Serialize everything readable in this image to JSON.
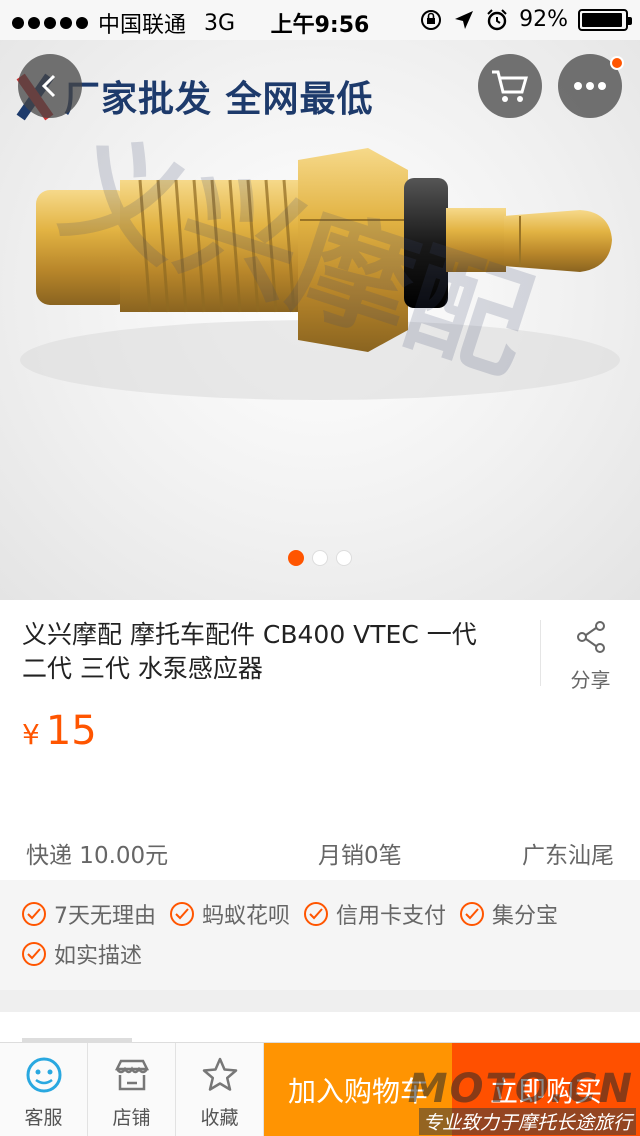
{
  "status_bar": {
    "carrier": "中国联通",
    "network": "3G",
    "time": "上午9:56",
    "battery": "92%",
    "battery_level": 0.92
  },
  "hero": {
    "watermark_banner": "厂家批发 全网最低",
    "watermark_brand": "义兴摩配",
    "page_indicator": {
      "count": 3,
      "active": 1
    }
  },
  "product": {
    "title": "义兴摩配 摩托车配件 CB400 VTEC 一代 二代 三代 水泵感应器",
    "share_label": "分享",
    "currency": "¥",
    "price": "15",
    "shipping": "快递 10.00元",
    "monthly_sales": "月销0笔",
    "location": "广东汕尾"
  },
  "services": [
    {
      "label": "7天无理由"
    },
    {
      "label": "蚂蚁花呗"
    },
    {
      "label": "信用卡支付"
    },
    {
      "label": "集分宝"
    },
    {
      "label": "如实描述"
    }
  ],
  "bottom_bar": {
    "tabs": [
      {
        "label": "客服",
        "icon": "customer-service-icon"
      },
      {
        "label": "店铺",
        "icon": "shop-icon"
      },
      {
        "label": "收藏",
        "icon": "star-icon"
      }
    ],
    "add_to_cart": "加入购物车",
    "buy_now": "立即购买"
  },
  "site_watermark": {
    "brand": "MOTO.CN",
    "tagline": "专业致力于摩托长途旅行"
  },
  "colors": {
    "accent": "#ff5500",
    "cart_button": "#ff9402",
    "buy_button": "#ff5000",
    "service_icon_blue": "#29a8e0"
  }
}
